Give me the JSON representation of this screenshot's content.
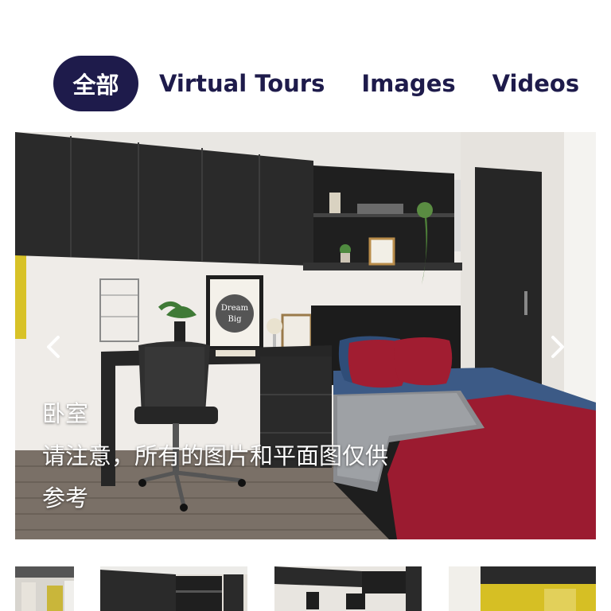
{
  "tabs": [
    {
      "label": "全部",
      "active": true
    },
    {
      "label": "Virtual Tours",
      "active": false
    },
    {
      "label": "Images",
      "active": false
    },
    {
      "label": "Videos",
      "active": false
    }
  ],
  "hero": {
    "caption_title": "卧室",
    "caption_note_line1": "请注意，所有的图片和平面图仅供",
    "caption_note_line2": "参考",
    "poster_text_1": "Dream",
    "poster_text_2": "Big"
  },
  "icons": {
    "prev": "chevron-left-icon",
    "next": "chevron-right-icon"
  },
  "colors": {
    "tab_active_bg": "#1e1b4b",
    "tab_text": "#1e1b4b",
    "bedspread": "#9b1b30"
  }
}
